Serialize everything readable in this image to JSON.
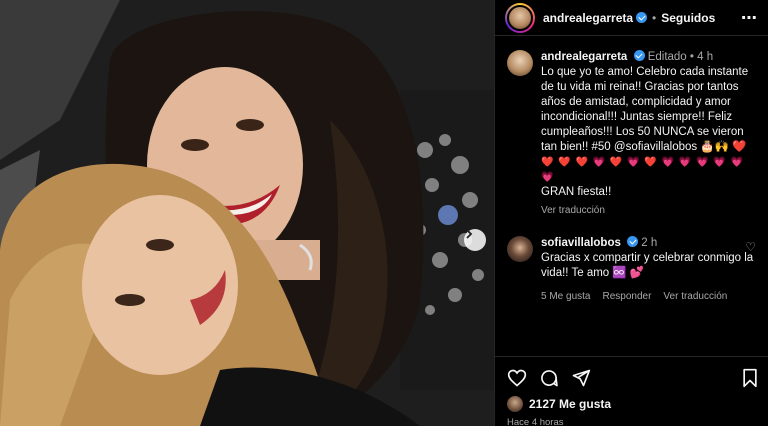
{
  "post": {
    "author": "andrealegarreta",
    "separator": "•",
    "follow_status": "Seguidos",
    "more_icon": "more-horizontal-icon",
    "photo_alt": "Selfie of two smiling women"
  },
  "caption": {
    "username": "andrealegarreta",
    "edited": "Editado",
    "dot": "•",
    "time": "4 h",
    "text": "Lo que yo te amo! Celebro cada instante de tu vida mi reina!! Gracias por tantos años de amistad, complicidad y amor incondicional!!! Juntas siempre!! Feliz cumpleaños!!! Los 50 NUNCA se vieron tan bien!! #50 @sofiavillalobos 🎂🙌 ❤️",
    "emojis": "❤️ ❤️ ❤️ 💗 ❤️ 💗 ❤️ 💗 💗 💗 💗 💗 💗",
    "tail": "GRAN fiesta!!",
    "translate": "Ver traducción"
  },
  "reply": {
    "username": "sofiavillalobos",
    "time": "2 h",
    "text": "Gracias x compartir y celebrar conmigo la vida!! Te amo ♾️ 💕",
    "likes": "5 Me gusta",
    "reply_label": "Responder",
    "translate": "Ver traducción"
  },
  "footer": {
    "likes": "2127 Me gusta",
    "time_ago": "Hace 4 horas"
  },
  "colors": {
    "verified": "#3897f0",
    "muted": "#a8a8a8",
    "background": "#000000"
  }
}
